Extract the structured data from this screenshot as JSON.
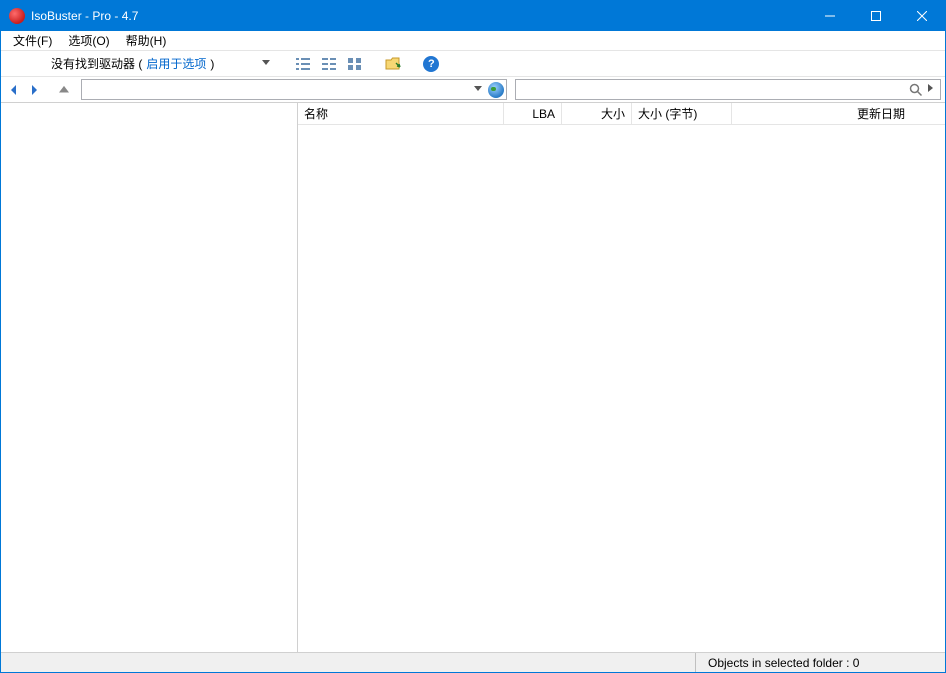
{
  "window": {
    "title": "IsoBuster - Pro - 4.7"
  },
  "menu": {
    "file": "文件(F)",
    "options": "选项(O)",
    "help": "帮助(H)"
  },
  "toolbar": {
    "no_drive_prefix": "没有找到驱动器 ( ",
    "enable_link": "启用于选项",
    "no_drive_suffix": " )"
  },
  "columns": {
    "name": "名称",
    "lba": "LBA",
    "size": "大小",
    "size_bytes": "大小 (字节)",
    "date": "更新日期"
  },
  "status": {
    "folder_count": "Objects in selected folder : 0"
  }
}
